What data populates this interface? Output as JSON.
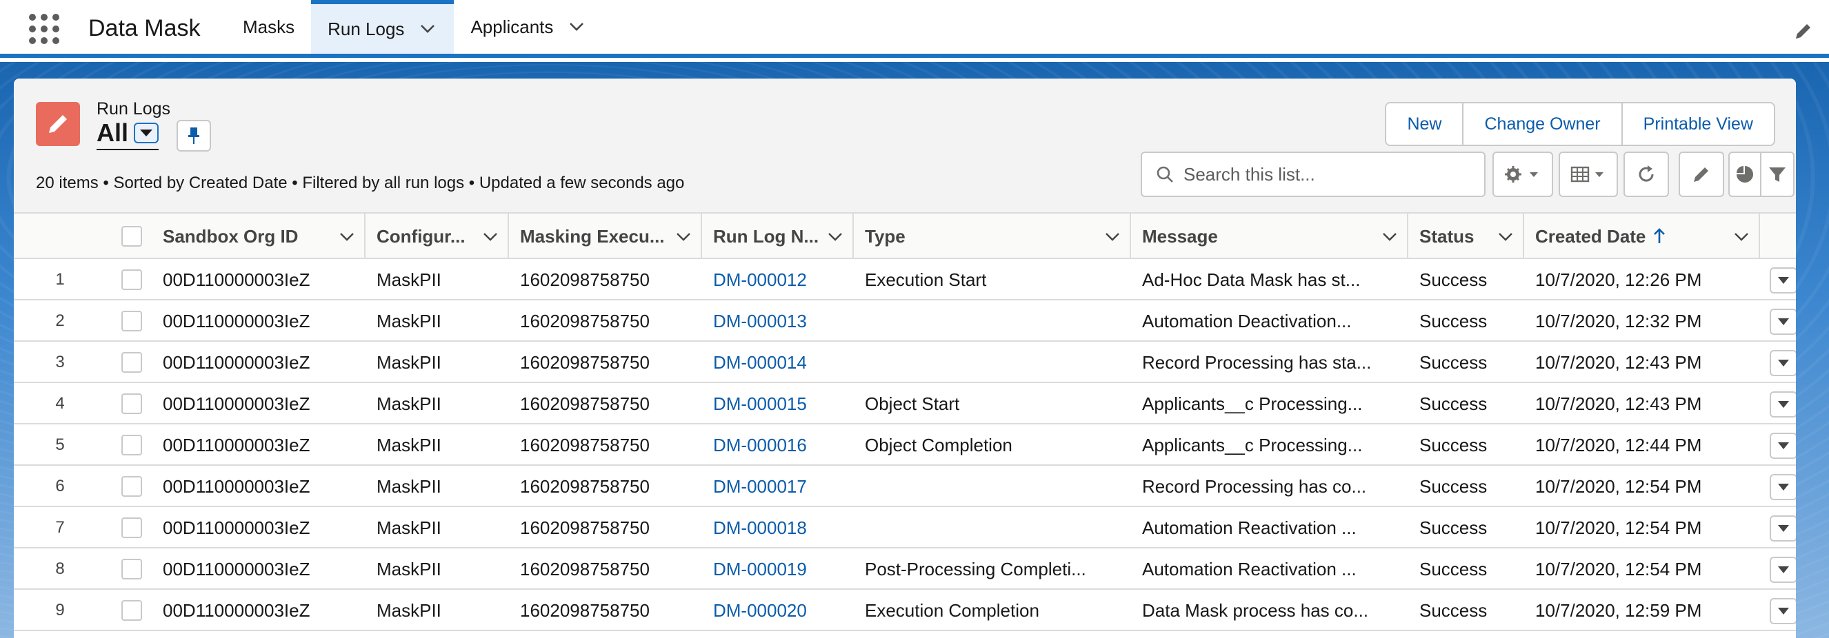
{
  "app": {
    "name": "Data Mask"
  },
  "nav": {
    "tabs": [
      {
        "label": "Masks"
      },
      {
        "label": "Run Logs"
      },
      {
        "label": "Applicants"
      }
    ]
  },
  "header": {
    "object_label": "Run Logs",
    "view_name": "All",
    "summary": "20 items • Sorted by Created Date • Filtered by all run logs • Updated a few seconds ago"
  },
  "actions": {
    "new": "New",
    "change_owner": "Change Owner",
    "printable_view": "Printable View"
  },
  "search": {
    "placeholder": "Search this list...",
    "value": ""
  },
  "columns": {
    "sandbox_org_id": "Sandbox Org ID",
    "configuration": "Configur...",
    "masking_execution": "Masking Execu...",
    "run_log_name": "Run Log N...",
    "type": "Type",
    "message": "Message",
    "status": "Status",
    "created_date": "Created Date"
  },
  "rows": [
    {
      "num": "1",
      "org": "00D110000003IeZ",
      "config": "MaskPII",
      "exec": "1602098758750",
      "name": "DM-000012",
      "type": "Execution Start",
      "message": "Ad-Hoc Data Mask has st...",
      "status": "Success",
      "created": "10/7/2020, 12:26 PM"
    },
    {
      "num": "2",
      "org": "00D110000003IeZ",
      "config": "MaskPII",
      "exec": "1602098758750",
      "name": "DM-000013",
      "type": "",
      "message": "Automation Deactivation...",
      "status": "Success",
      "created": "10/7/2020, 12:32 PM"
    },
    {
      "num": "3",
      "org": "00D110000003IeZ",
      "config": "MaskPII",
      "exec": "1602098758750",
      "name": "DM-000014",
      "type": "",
      "message": "Record Processing has sta...",
      "status": "Success",
      "created": "10/7/2020, 12:43 PM"
    },
    {
      "num": "4",
      "org": "00D110000003IeZ",
      "config": "MaskPII",
      "exec": "1602098758750",
      "name": "DM-000015",
      "type": "Object Start",
      "message": "Applicants__c Processing...",
      "status": "Success",
      "created": "10/7/2020, 12:43 PM"
    },
    {
      "num": "5",
      "org": "00D110000003IeZ",
      "config": "MaskPII",
      "exec": "1602098758750",
      "name": "DM-000016",
      "type": "Object Completion",
      "message": "Applicants__c Processing...",
      "status": "Success",
      "created": "10/7/2020, 12:44 PM"
    },
    {
      "num": "6",
      "org": "00D110000003IeZ",
      "config": "MaskPII",
      "exec": "1602098758750",
      "name": "DM-000017",
      "type": "",
      "message": "Record Processing has co...",
      "status": "Success",
      "created": "10/7/2020, 12:54 PM"
    },
    {
      "num": "7",
      "org": "00D110000003IeZ",
      "config": "MaskPII",
      "exec": "1602098758750",
      "name": "DM-000018",
      "type": "",
      "message": "Automation Reactivation ...",
      "status": "Success",
      "created": "10/7/2020, 12:54 PM"
    },
    {
      "num": "8",
      "org": "00D110000003IeZ",
      "config": "MaskPII",
      "exec": "1602098758750",
      "name": "DM-000019",
      "type": "Post-Processing Completi...",
      "message": "Automation Reactivation ...",
      "status": "Success",
      "created": "10/7/2020, 12:54 PM"
    },
    {
      "num": "9",
      "org": "00D110000003IeZ",
      "config": "MaskPII",
      "exec": "1602098758750",
      "name": "DM-000020",
      "type": "Execution Completion",
      "message": "Data Mask process has co...",
      "status": "Success",
      "created": "10/7/2020, 12:59 PM"
    }
  ],
  "colors": {
    "brand": "#1b73c4",
    "link": "#0b5cab",
    "list_icon": "#e96b5d"
  },
  "icons": [
    "app-launcher-icon",
    "chevron-down-icon",
    "edit-icon",
    "pin-icon",
    "search-icon",
    "gear-icon",
    "table-icon",
    "refresh-icon",
    "pie-chart-icon",
    "filter-icon",
    "arrow-up-icon"
  ]
}
